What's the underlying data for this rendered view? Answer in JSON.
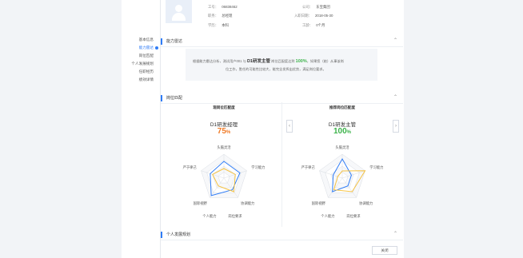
{
  "profile": {
    "fields": [
      {
        "label": "工号：",
        "value": "06838462"
      },
      {
        "label": "公司：",
        "value": "东宝集团"
      },
      {
        "label": "职务：",
        "value": "总经理"
      },
      {
        "label": "入职日期：",
        "value": "2018-05-30"
      },
      {
        "label": "学历：",
        "value": "本科"
      },
      {
        "label": "工龄：",
        "value": "0个月"
      }
    ]
  },
  "sidenav": {
    "items": [
      {
        "label": "基本信息"
      },
      {
        "label": "能力雷达"
      },
      {
        "label": "岗位匹配"
      },
      {
        "label": "个人发展规划"
      },
      {
        "label": "任职经历"
      },
      {
        "label": "绩效详情"
      }
    ],
    "active_index": 1
  },
  "sections": {
    "ability": {
      "title": "能力雷达"
    },
    "match": {
      "title": "岗位匹配"
    },
    "plan": {
      "title": "个人发展规划"
    }
  },
  "analysis": {
    "line1_pre": "根据能力雷达分析，测试用户001 与",
    "role": "D1研发主管",
    "line1_mid": "岗位匹配度达到",
    "percent": "100%",
    "line1_post": "，如果您（她）从事该岗",
    "line2": "位工作，胜任的可能性比较大，能完全发挥出优势，满足岗位要求。"
  },
  "current_match": {
    "title": "现岗位匹配度",
    "role": "D1研发经理",
    "percent_number": "75",
    "percent_sign": "%",
    "color": "#f07a26"
  },
  "recommended_match": {
    "title": "推荐岗位匹配度",
    "role": "D1研发主管",
    "percent_number": "100",
    "percent_sign": "%",
    "color": "#3cb34a"
  },
  "radar_axes": [
    "头脑灵活",
    "学习能力",
    "协调能力",
    "个人能力",
    "岗位要求",
    "国际视野",
    "严于律己"
  ],
  "chart_data": [
    {
      "type": "radar",
      "title": "现岗位匹配度",
      "axes": [
        "头脑灵活",
        "学习能力",
        "协调能力",
        "国际视野",
        "严于律己"
      ],
      "series": [
        {
          "name": "个人能力",
          "color": "#2f7cf6",
          "values": [
            70,
            70,
            60,
            90,
            60
          ]
        },
        {
          "name": "岗位要求",
          "color": "#f5c242",
          "values": [
            40,
            50,
            70,
            40,
            50
          ]
        }
      ],
      "range": [
        0,
        100
      ]
    },
    {
      "type": "radar",
      "title": "推荐岗位匹配度",
      "axes": [
        "头脑灵活",
        "学习能力",
        "协调能力",
        "国际视野",
        "严于律己"
      ],
      "series": [
        {
          "name": "个人能力",
          "color": "#2f7cf6",
          "values": [
            80,
            40,
            40,
            70,
            40
          ]
        },
        {
          "name": "岗位要求",
          "color": "#f5c242",
          "values": [
            30,
            100,
            70,
            60,
            20
          ]
        }
      ],
      "range": [
        0,
        100
      ]
    }
  ],
  "buttons": {
    "close_label": "关闭",
    "prev_glyph": "‹",
    "next_glyph": "›",
    "collapse_glyph": "⌃"
  },
  "colors": {
    "accent": "#2f7cf6",
    "personal": "#2f7cf6",
    "required": "#f5c242"
  }
}
